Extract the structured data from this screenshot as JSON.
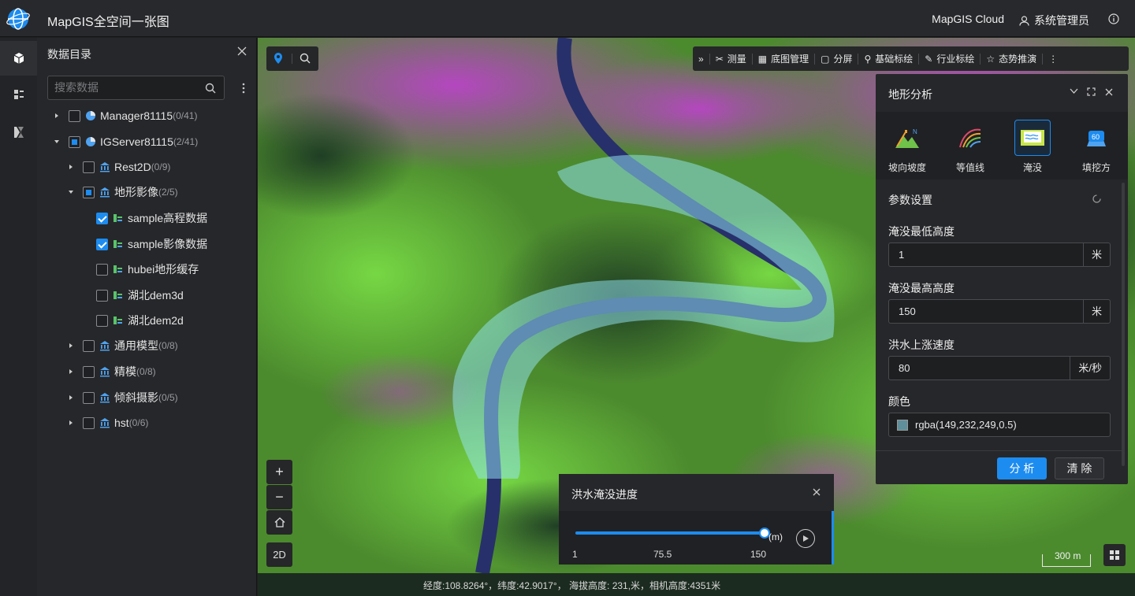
{
  "header": {
    "title": "MapGIS全空间一张图",
    "cloud_link": "MapGIS Cloud",
    "user": "系统管理员"
  },
  "catalog": {
    "title": "数据目录",
    "search_placeholder": "搜索数据",
    "tree": [
      {
        "label": "Manager81115",
        "count": "(0/41)"
      },
      {
        "label": "IGServer81115",
        "count": "(2/41)"
      },
      {
        "label": "Rest2D",
        "count": "(0/9)"
      },
      {
        "label": "地形影像",
        "count": "(2/5)"
      },
      {
        "label": "sample高程数据",
        "count": ""
      },
      {
        "label": "sample影像数据",
        "count": ""
      },
      {
        "label": "hubei地形缓存",
        "count": ""
      },
      {
        "label": "湖北dem3d",
        "count": ""
      },
      {
        "label": "湖北dem2d",
        "count": ""
      },
      {
        "label": "通用模型",
        "count": "(0/8)"
      },
      {
        "label": "精模",
        "count": "(0/8)"
      },
      {
        "label": "倾斜摄影",
        "count": "(0/5)"
      },
      {
        "label": "hst",
        "count": "(0/6)"
      }
    ]
  },
  "toolbar": {
    "items": [
      "测量",
      "底图管理",
      "分屏",
      "基础标绘",
      "行业标绘",
      "态势推演"
    ]
  },
  "map_controls": {
    "mode": "2D",
    "scale": "300 m"
  },
  "terrain_panel": {
    "title": "地形分析",
    "tabs": [
      "坡向坡度",
      "等值线",
      "淹没",
      "填挖方"
    ],
    "params_title": "参数设置",
    "min_label": "淹没最低高度",
    "min_value": "1",
    "min_unit": "米",
    "max_label": "淹没最高高度",
    "max_value": "150",
    "max_unit": "米",
    "speed_label": "洪水上涨速度",
    "speed_value": "80",
    "speed_unit": "米/秒",
    "color_label": "颜色",
    "color_value": "rgba(149,232,249,0.5)",
    "analyze": "分 析",
    "clear": "清 除"
  },
  "flood_panel": {
    "title": "洪水淹没进度",
    "unit": "(m)",
    "ticks": [
      "1",
      "75.5",
      "150"
    ],
    "progress": 1.0
  },
  "status": {
    "text": "经度:108.8264°，纬度:42.9017°， 海拔高度: 231,米，相机高度:4351米"
  },
  "colors": {
    "accent": "#1d8cf0",
    "flood": "#95e8f9"
  }
}
